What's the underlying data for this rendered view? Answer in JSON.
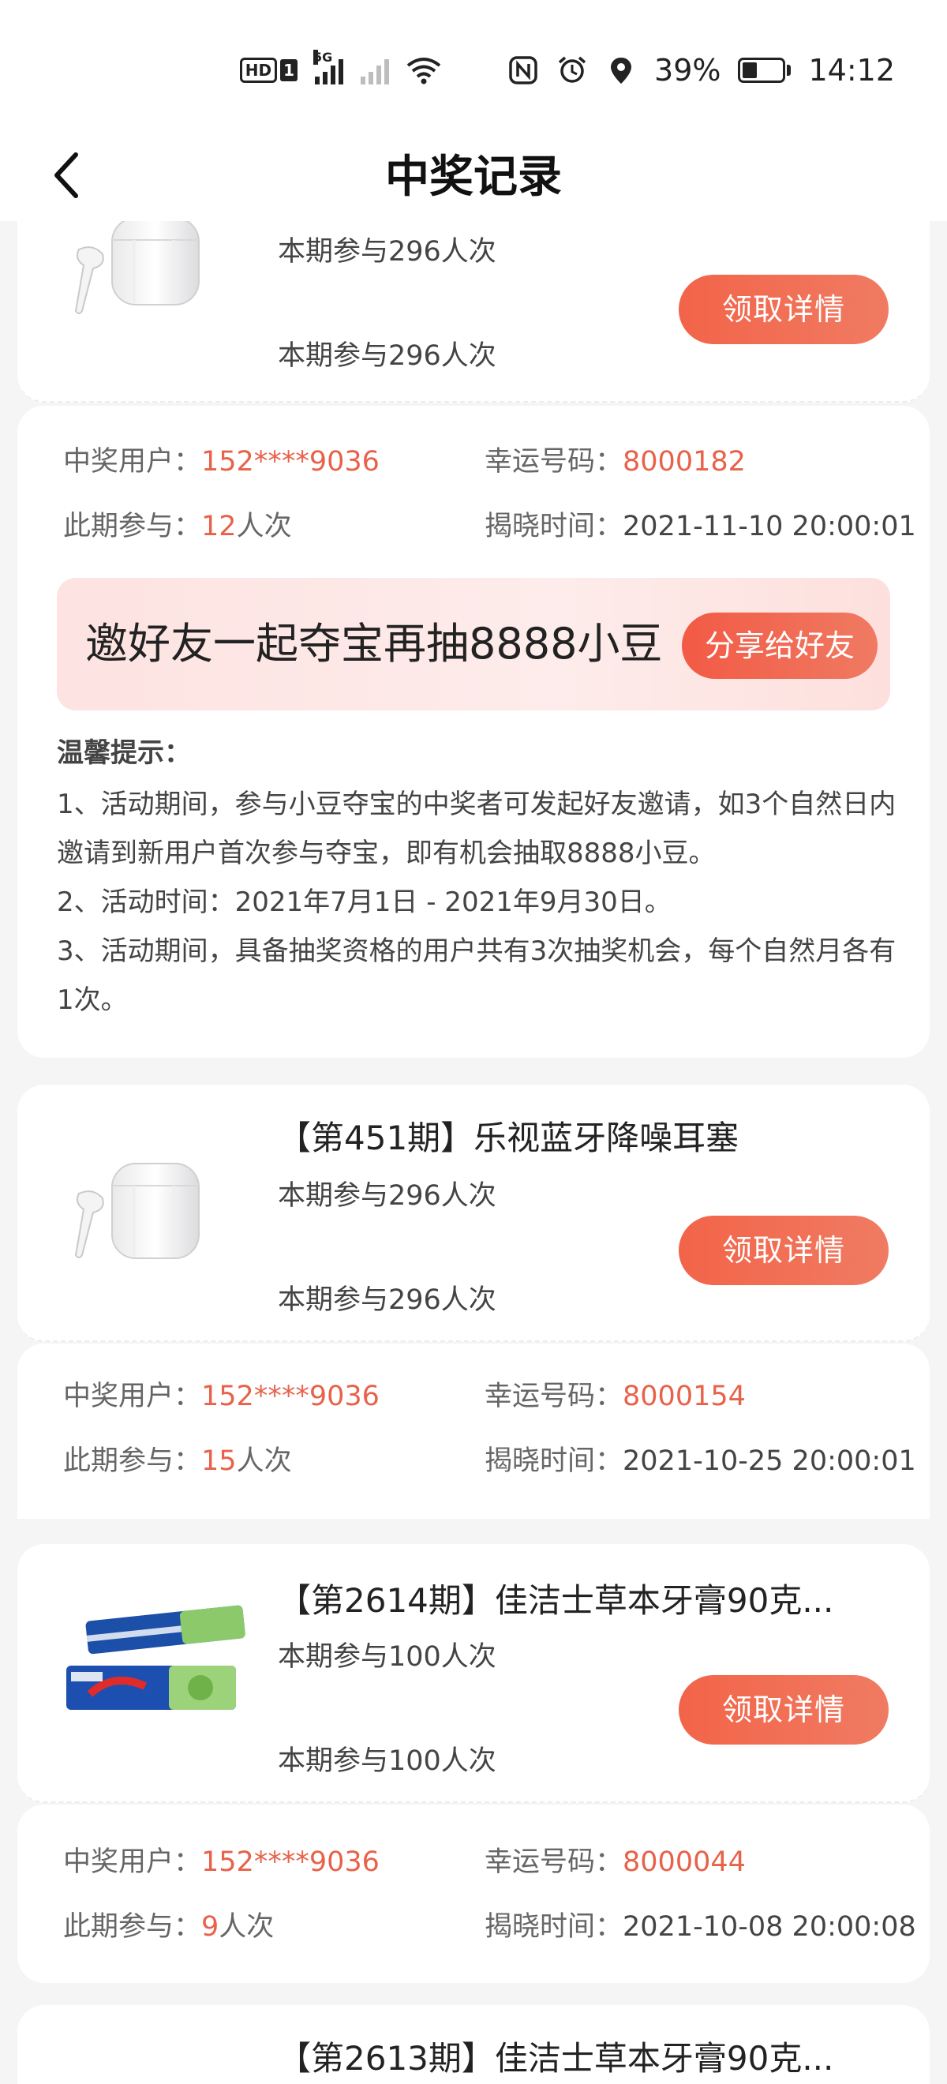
{
  "status_bar": {
    "hd": "HD",
    "sim": "1",
    "net": "5G",
    "battery": "39%",
    "time": "14:12"
  },
  "header": {
    "title": "中奖记录"
  },
  "record1": {
    "line1": "本期参与296人次",
    "line2": "本期参与296人次",
    "claim": "领取详情",
    "winner_label": "中奖用户：",
    "winner": "152****9036",
    "lucky_label": "幸运号码：",
    "lucky": "8000182",
    "joined_label": "此期参与：",
    "joined_num": "12",
    "joined_unit": "人次",
    "reveal_label": "揭晓时间：",
    "reveal": "2021-11-10 20:00:01",
    "invite_text": "邀好友一起夺宝再抽8888小豆",
    "share": "分享给好友",
    "tips_title": "温馨提示：",
    "tips": [
      "1、活动期间，参与小豆夺宝的中奖者可发起好友邀请，如3个自然日内邀请到新用户首次参与夺宝，即有机会抽取8888小豆。",
      "2、活动时间：2021年7月1日 - 2021年9月30日。",
      "3、活动期间，具备抽奖资格的用户共有3次抽奖机会，每个自然月各有1次。"
    ]
  },
  "record2": {
    "title": "【第451期】乐视蓝牙降噪耳塞",
    "line1": "本期参与296人次",
    "line2": "本期参与296人次",
    "claim": "领取详情",
    "winner_label": "中奖用户：",
    "winner": "152****9036",
    "lucky_label": "幸运号码：",
    "lucky": "8000154",
    "joined_label": "此期参与：",
    "joined_num": "15",
    "joined_unit": "人次",
    "reveal_label": "揭晓时间：",
    "reveal": "2021-10-25 20:00:01"
  },
  "record3": {
    "title": "【第2614期】佳洁士草本牙膏90克...",
    "line1": "本期参与100人次",
    "line2": "本期参与100人次",
    "claim": "领取详情",
    "winner_label": "中奖用户：",
    "winner": "152****9036",
    "lucky_label": "幸运号码：",
    "lucky": "8000044",
    "joined_label": "此期参与：",
    "joined_num": "9",
    "joined_unit": "人次",
    "reveal_label": "揭晓时间：",
    "reveal": "2021-10-08 20:00:08"
  },
  "record4": {
    "title": "【第2613期】佳洁士草本牙膏90克..."
  },
  "colors": {
    "accent": "#f26449",
    "highlight": "#e8624a",
    "banner": "#fde3e1"
  },
  "icons": {
    "back": "back-arrow-icon",
    "earbuds": "earbuds-product-image",
    "toothpaste": "toothpaste-product-image"
  }
}
